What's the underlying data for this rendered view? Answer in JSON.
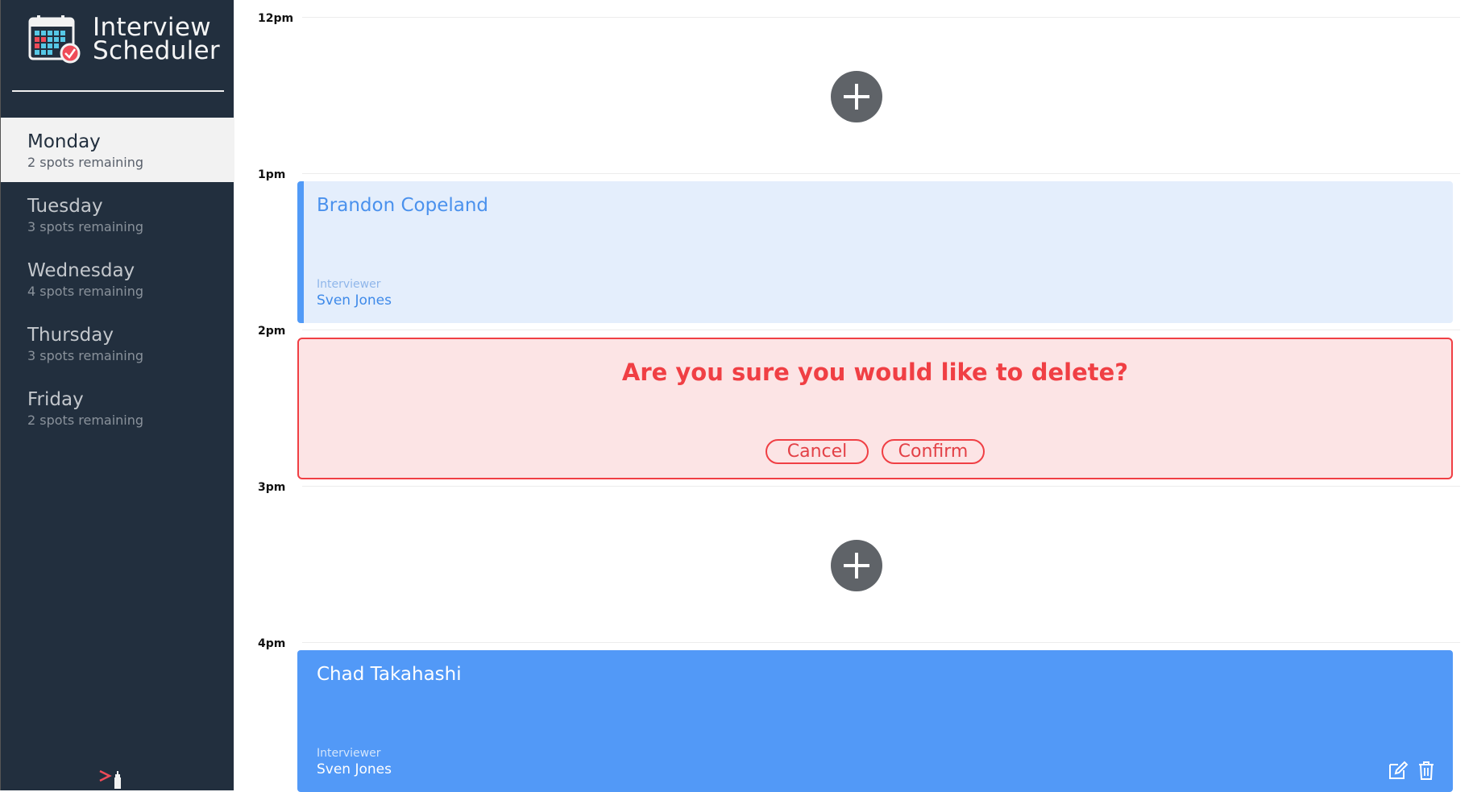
{
  "brand": {
    "title": "Interview\nScheduler"
  },
  "days": [
    {
      "name": "Monday",
      "spots": "2 spots remaining",
      "selected": true
    },
    {
      "name": "Tuesday",
      "spots": "3 spots remaining",
      "selected": false
    },
    {
      "name": "Wednesday",
      "spots": "4 spots remaining",
      "selected": false
    },
    {
      "name": "Thursday",
      "spots": "3 spots remaining",
      "selected": false
    },
    {
      "name": "Friday",
      "spots": "2 spots remaining",
      "selected": false
    }
  ],
  "schedule": [
    {
      "time": "12pm",
      "state": "empty"
    },
    {
      "time": "1pm",
      "state": "booked",
      "student": "Brandon Copeland",
      "interviewer_label": "Interviewer",
      "interviewer": "Sven Jones"
    },
    {
      "time": "2pm",
      "state": "confirm",
      "message": "Are you sure you would like to delete?",
      "cancel_label": "Cancel",
      "confirm_label": "Confirm"
    },
    {
      "time": "3pm",
      "state": "empty"
    },
    {
      "time": "4pm",
      "state": "booked",
      "student": "Chad Takahashi",
      "interviewer_label": "Interviewer",
      "interviewer": "Sven Jones"
    }
  ],
  "icons": {
    "brand": "calendar-check-icon",
    "add": "plus-icon",
    "edit": "edit-icon",
    "delete": "trash-icon",
    "footer": "lighthouse-logo-icon"
  },
  "colors": {
    "sidebar": "#222f3e",
    "selected_day": "#f2f2f2",
    "appointment": "#5299f7",
    "appointment_light": "#e4eefc",
    "danger": "#f03f44",
    "danger_bg": "#fce4e5",
    "add_button": "#5f6368"
  }
}
